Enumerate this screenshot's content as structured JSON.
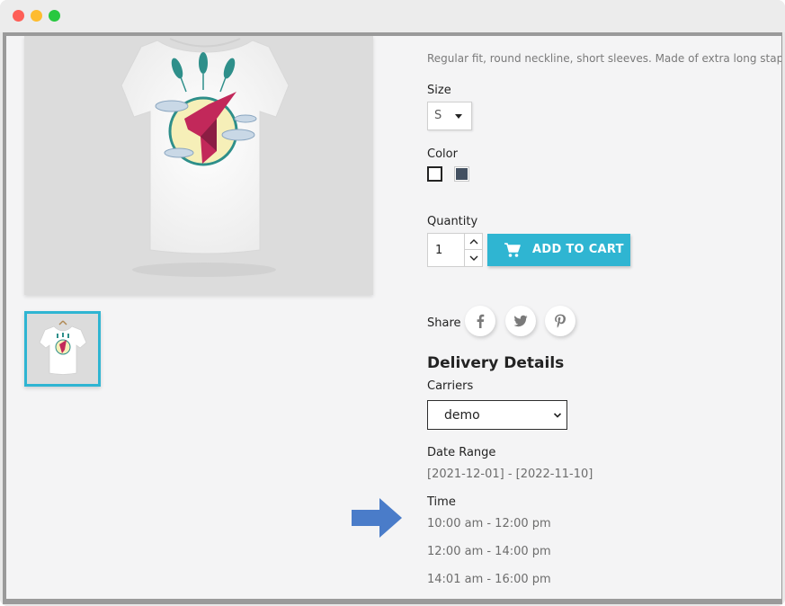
{
  "window": {
    "controls": [
      "close",
      "minimize",
      "maximize"
    ]
  },
  "product": {
    "description": "Regular fit, round neckline, short sleeves. Made of extra long staple pima c",
    "size_label": "Size",
    "size_value": "S",
    "color_label": "Color",
    "colors": [
      "#ffffff",
      "#435061"
    ],
    "quantity_label": "Quantity",
    "quantity_value": "1",
    "add_to_cart_label": "ADD TO CART",
    "share_label": "Share",
    "accent": "#2fb5d2"
  },
  "delivery": {
    "title": "Delivery Details",
    "carriers_label": "Carriers",
    "carrier_value": "demo",
    "date_range_label": "Date Range",
    "date_range_value": "[2021-12-01] - [2022-11-10]",
    "time_label": "Time",
    "time_slots": [
      "10:00 am - 12:00 pm",
      "12:00 am - 14:00 pm",
      "14:01 am - 16:00 pm"
    ]
  },
  "icons": {
    "facebook": "facebook-icon",
    "twitter": "twitter-icon",
    "pinterest": "pinterest-icon",
    "cart": "cart-icon",
    "arrow_color": "#4a7cc9"
  }
}
